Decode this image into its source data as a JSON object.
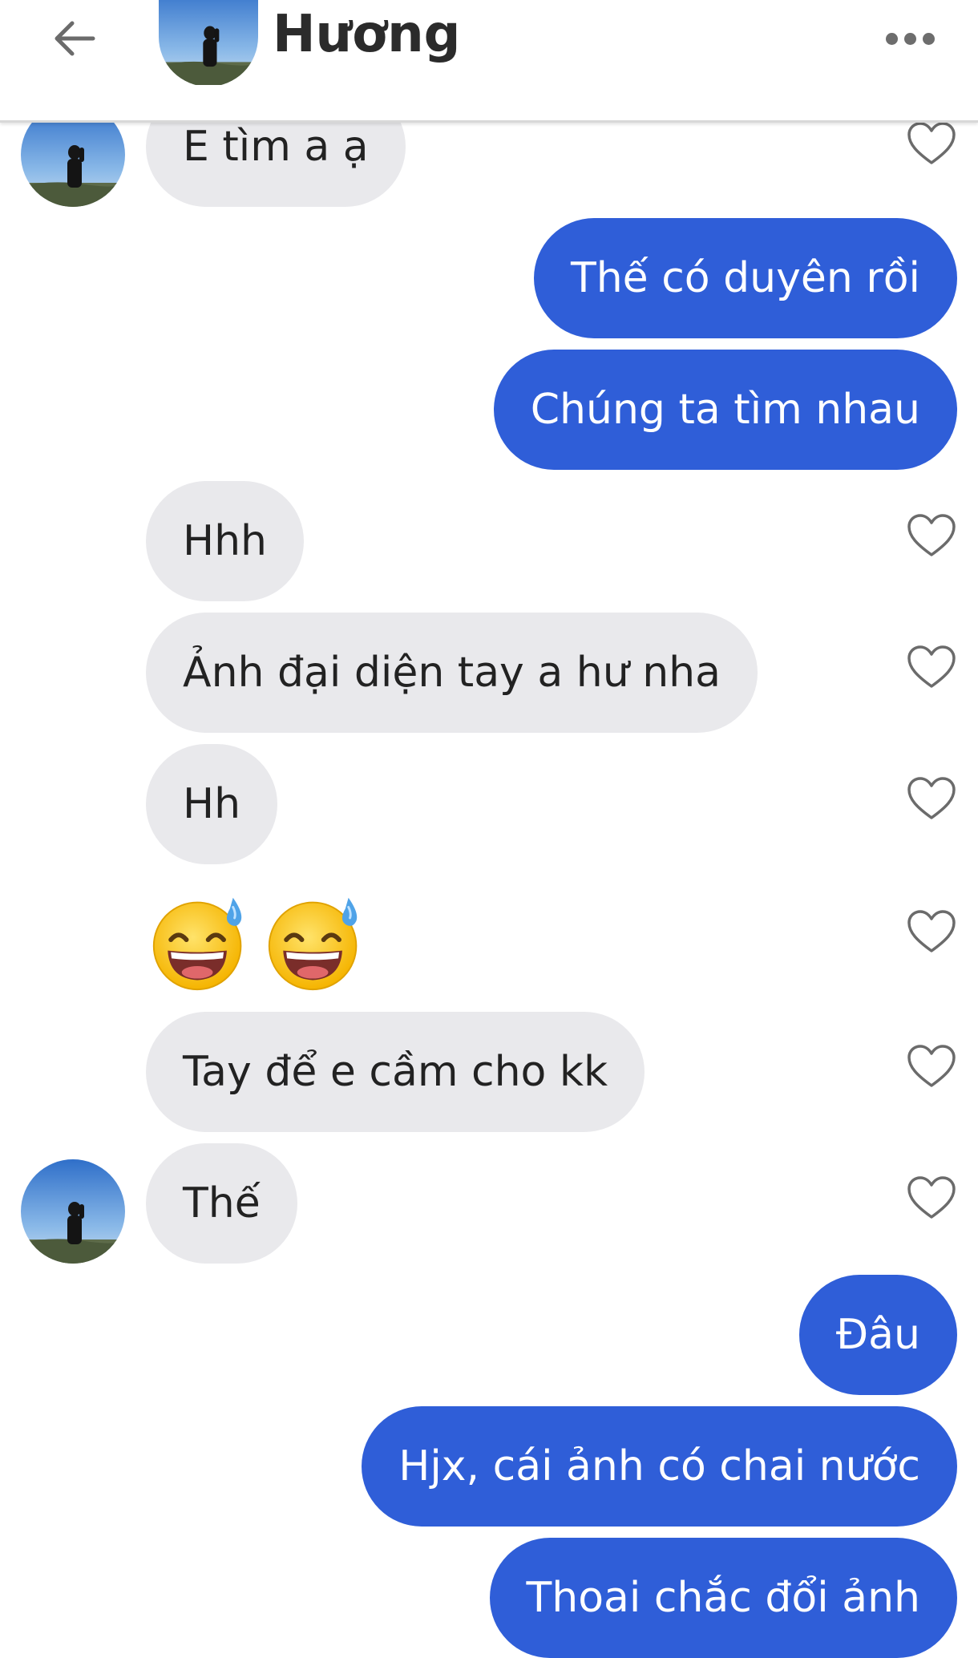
{
  "header": {
    "contact_name": "Hương",
    "icons": {
      "back": "back-arrow-icon",
      "more": "more-options-icon"
    }
  },
  "colors": {
    "outgoing_bubble": "#2f5ed8",
    "incoming_bubble": "#e9e9ec",
    "heart_outline": "#6b6b6b"
  },
  "messages": [
    {
      "text": "E tìm a ạ",
      "direction": "incoming",
      "avatar": true,
      "like_button": true
    },
    {
      "text": "Thế có duyên rồi",
      "direction": "outgoing"
    },
    {
      "text": "Chúng ta tìm nhau",
      "direction": "outgoing"
    },
    {
      "text": "Hhh",
      "direction": "incoming",
      "like_button": true
    },
    {
      "text": "Ảnh đại diện tay a hư nha",
      "direction": "incoming",
      "like_button": true
    },
    {
      "text": "Hh",
      "direction": "incoming",
      "like_button": true
    },
    {
      "text": "",
      "emojis": [
        "grinning-face-with-sweat",
        "grinning-face-with-sweat"
      ],
      "direction": "incoming",
      "like_button": true
    },
    {
      "text": "Tay để e cầm cho kk",
      "direction": "incoming",
      "like_button": true
    },
    {
      "text": "Thế",
      "direction": "incoming",
      "avatar": true,
      "like_button": true
    },
    {
      "text": "Đâu",
      "direction": "outgoing"
    },
    {
      "text": "Hjx, cái ảnh có chai nước",
      "direction": "outgoing"
    },
    {
      "text": "Thoai chắc đổi ảnh",
      "direction": "outgoing"
    }
  ]
}
